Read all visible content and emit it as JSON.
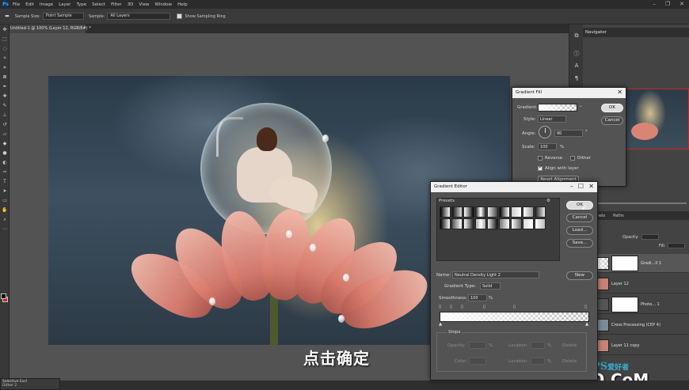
{
  "menu": {
    "app_logo": "Ps",
    "items": [
      "File",
      "Edit",
      "Image",
      "Layer",
      "Type",
      "Select",
      "Filter",
      "3D",
      "View",
      "Window",
      "Help"
    ]
  },
  "options_bar": {
    "sample_size_label": "Sample Size:",
    "sample_size_value": "Point Sample",
    "sample_label": "Sample:",
    "sample_value": "All Layers",
    "show_ring_label": "Show Sampling Ring"
  },
  "document": {
    "tab_title": "Untitled-1 @ 100% (Layer 12, RGB/8#) *",
    "subtitle": "点击确定"
  },
  "panels": {
    "navigator_title": "Navigator",
    "tabs": [
      "Channels",
      "Paths"
    ],
    "opacity_label": "Opacity:",
    "fill_label": "Fill:",
    "layers": [
      {
        "name": "Gradi...ll 1"
      },
      {
        "name": "Layer 12"
      },
      {
        "name": "Photo... 1"
      },
      {
        "name": "Cross Processing (CEP 4)"
      },
      {
        "name": "Layer 11 copy"
      }
    ]
  },
  "mini_panel": {
    "title": "Selective Excl",
    "item": "Dither 2"
  },
  "gradient_fill": {
    "title": "Gradient Fill",
    "gradient_label": "Gradient:",
    "style_label": "Style:",
    "style_value": "Linear",
    "angle_label": "Angle:",
    "angle_value": "90",
    "angle_unit": "°",
    "scale_label": "Scale:",
    "scale_value": "100",
    "scale_unit": "%",
    "reverse_label": "Reverse",
    "dither_label": "Dither",
    "align_label": "Align with layer",
    "reset_label": "Reset Alignment",
    "ok_label": "OK",
    "cancel_label": "Cancel"
  },
  "gradient_editor": {
    "title": "Gradient Editor",
    "presets_label": "Presets",
    "ok_label": "OK",
    "cancel_label": "Cancel",
    "load_label": "Load...",
    "save_label": "Save...",
    "name_label": "Name:",
    "name_value": "Neutral Density Light 2",
    "new_label": "New",
    "gradient_type_label": "Gradient Type:",
    "gradient_type_value": "Solid",
    "smoothness_label": "Smoothness:",
    "smoothness_value": "100",
    "smoothness_unit": "%",
    "stops_label": "Stops",
    "opacity_label": "Opacity:",
    "opacity_unit": "%",
    "location_label": "Location:",
    "location_unit": "%",
    "delete_label": "Delete",
    "color_label": "Color:"
  },
  "watermark": {
    "ps_text": "PS",
    "ps_suffix": "爱好者",
    "brand": "UiBQ.CoM"
  }
}
